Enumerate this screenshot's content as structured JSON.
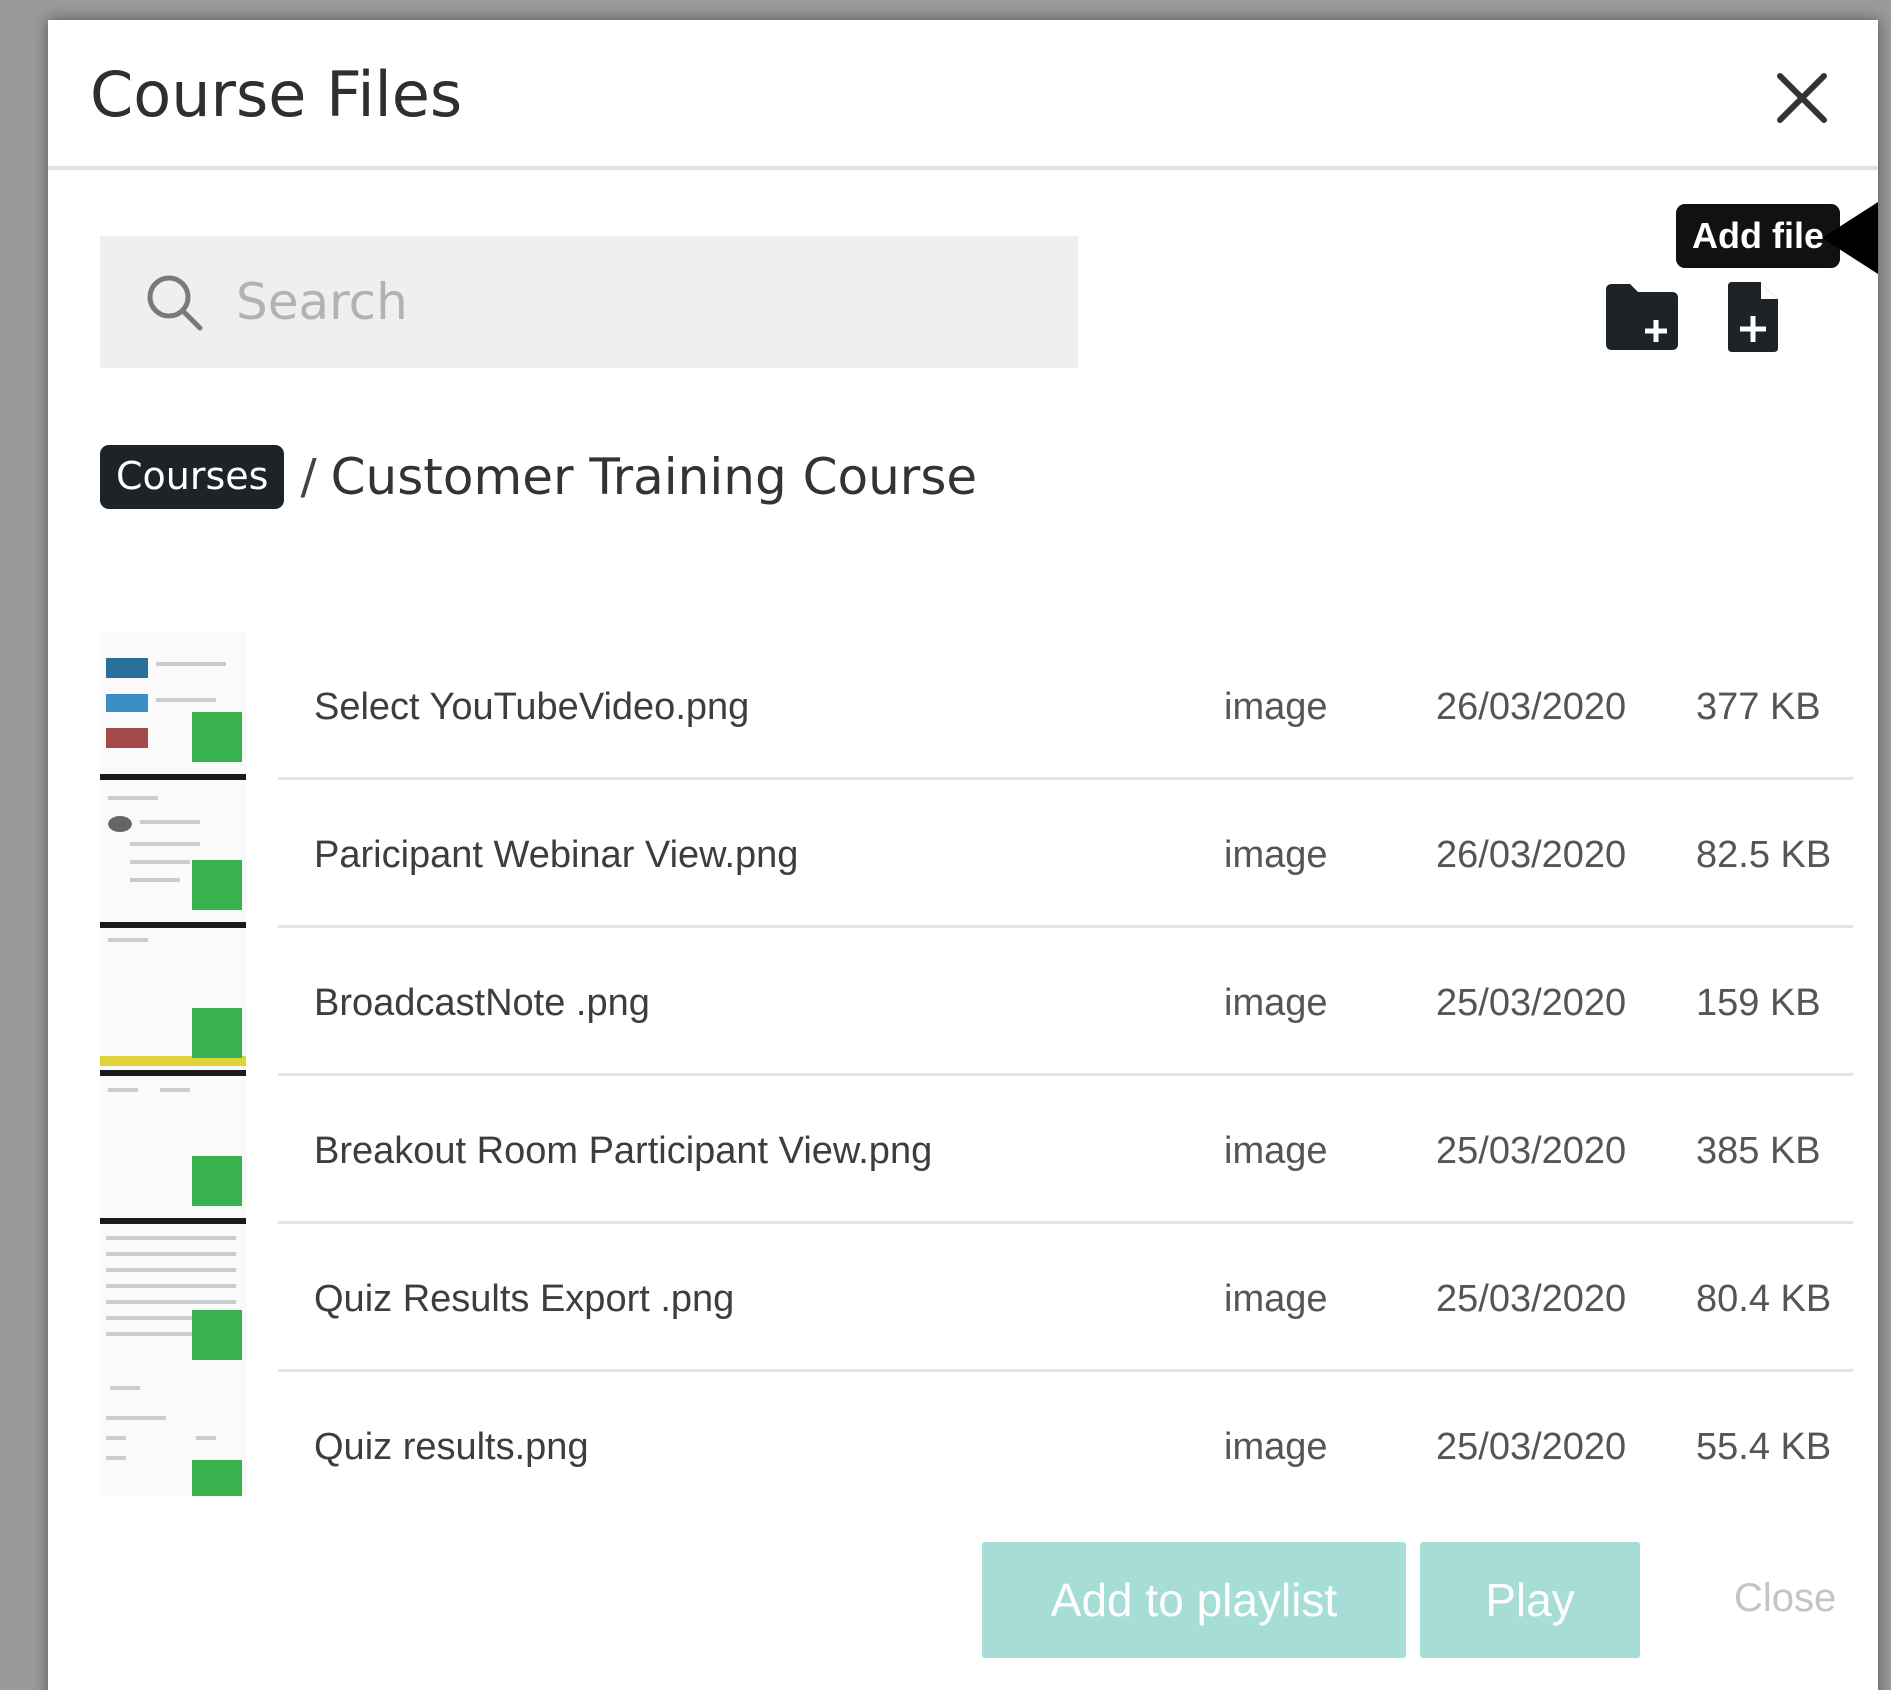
{
  "dialog": {
    "title": "Course Files",
    "close_icon": "close-icon"
  },
  "search": {
    "placeholder": "Search",
    "value": "",
    "icon": "search-icon"
  },
  "toolbar": {
    "tooltip": "Add file",
    "add_folder_icon": "folder-plus-icon",
    "add_file_icon": "file-plus-icon",
    "icon_color": "#1e2327"
  },
  "breadcrumb": {
    "root": "Courses",
    "separator": "/",
    "current": "Customer Training Course"
  },
  "files": [
    {
      "name": "Select YouTubeVideo.png",
      "type": "image",
      "date": "26/03/2020",
      "size": "377 KB",
      "icon": "image-icon"
    },
    {
      "name": "Paricipant Webinar View.png",
      "type": "image",
      "date": "26/03/2020",
      "size": "82.5 KB",
      "icon": "image-icon"
    },
    {
      "name": "BroadcastNote .png",
      "type": "image",
      "date": "25/03/2020",
      "size": "159 KB",
      "icon": "image-icon"
    },
    {
      "name": "Breakout Room Participant View.png",
      "type": "image",
      "date": "25/03/2020",
      "size": "385 KB",
      "icon": "image-icon"
    },
    {
      "name": "Quiz Results Export .png",
      "type": "image",
      "date": "25/03/2020",
      "size": "80.4 KB",
      "icon": "image-icon"
    },
    {
      "name": "Quiz results.png",
      "type": "image",
      "date": "25/03/2020",
      "size": "55.4 KB",
      "icon": "image-icon"
    }
  ],
  "footer": {
    "add_to_playlist": "Add to playlist",
    "play": "Play",
    "close": "Close"
  },
  "colors": {
    "primary_disabled": "#a6ddd6",
    "image_badge": "#37b24d",
    "dark": "#1e2327"
  }
}
